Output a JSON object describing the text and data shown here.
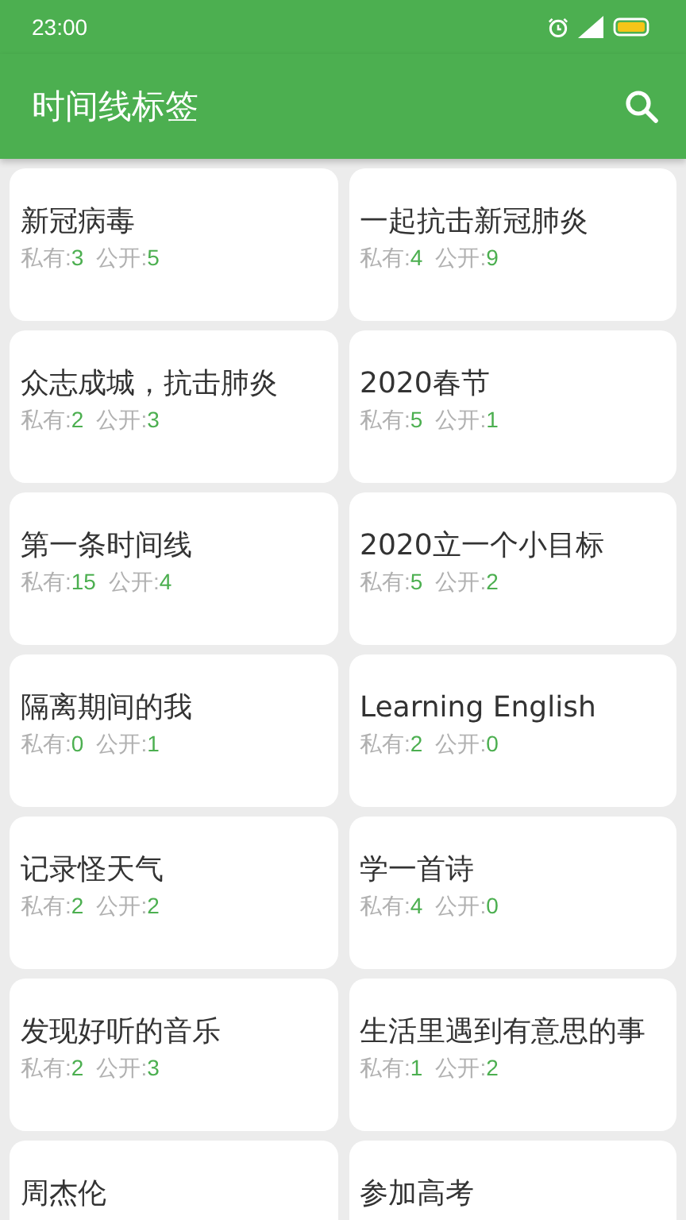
{
  "status_bar": {
    "time": "23:00"
  },
  "app_bar": {
    "title": "时间线标签"
  },
  "cards": [
    {
      "title": "新冠病毒",
      "private_label": "私有:",
      "private": "3",
      "public_label": "公开:",
      "public": "5"
    },
    {
      "title": "一起抗击新冠肺炎",
      "private_label": "私有:",
      "private": "4",
      "public_label": "公开:",
      "public": "9"
    },
    {
      "title": "众志成城，抗击肺炎",
      "private_label": "私有:",
      "private": "2",
      "public_label": "公开:",
      "public": "3"
    },
    {
      "title": "2020春节",
      "private_label": "私有:",
      "private": "5",
      "public_label": "公开:",
      "public": "1"
    },
    {
      "title": "第一条时间线",
      "private_label": "私有:",
      "private": "15",
      "public_label": "公开:",
      "public": "4"
    },
    {
      "title": "2020立一个小目标",
      "private_label": "私有:",
      "private": "5",
      "public_label": "公开:",
      "public": "2"
    },
    {
      "title": "隔离期间的我",
      "private_label": "私有:",
      "private": "0",
      "public_label": "公开:",
      "public": "1"
    },
    {
      "title": "Learning English",
      "private_label": "私有:",
      "private": "2",
      "public_label": "公开:",
      "public": "0"
    },
    {
      "title": "记录怪天气",
      "private_label": "私有:",
      "private": "2",
      "public_label": "公开:",
      "public": "2"
    },
    {
      "title": "学一首诗",
      "private_label": "私有:",
      "private": "4",
      "public_label": "公开:",
      "public": "0"
    },
    {
      "title": "发现好听的音乐",
      "private_label": "私有:",
      "private": "2",
      "public_label": "公开:",
      "public": "3"
    },
    {
      "title": "生活里遇到有意思的事",
      "private_label": "私有:",
      "private": "1",
      "public_label": "公开:",
      "public": "2"
    },
    {
      "title": "周杰伦"
    },
    {
      "title": "参加高考"
    }
  ]
}
